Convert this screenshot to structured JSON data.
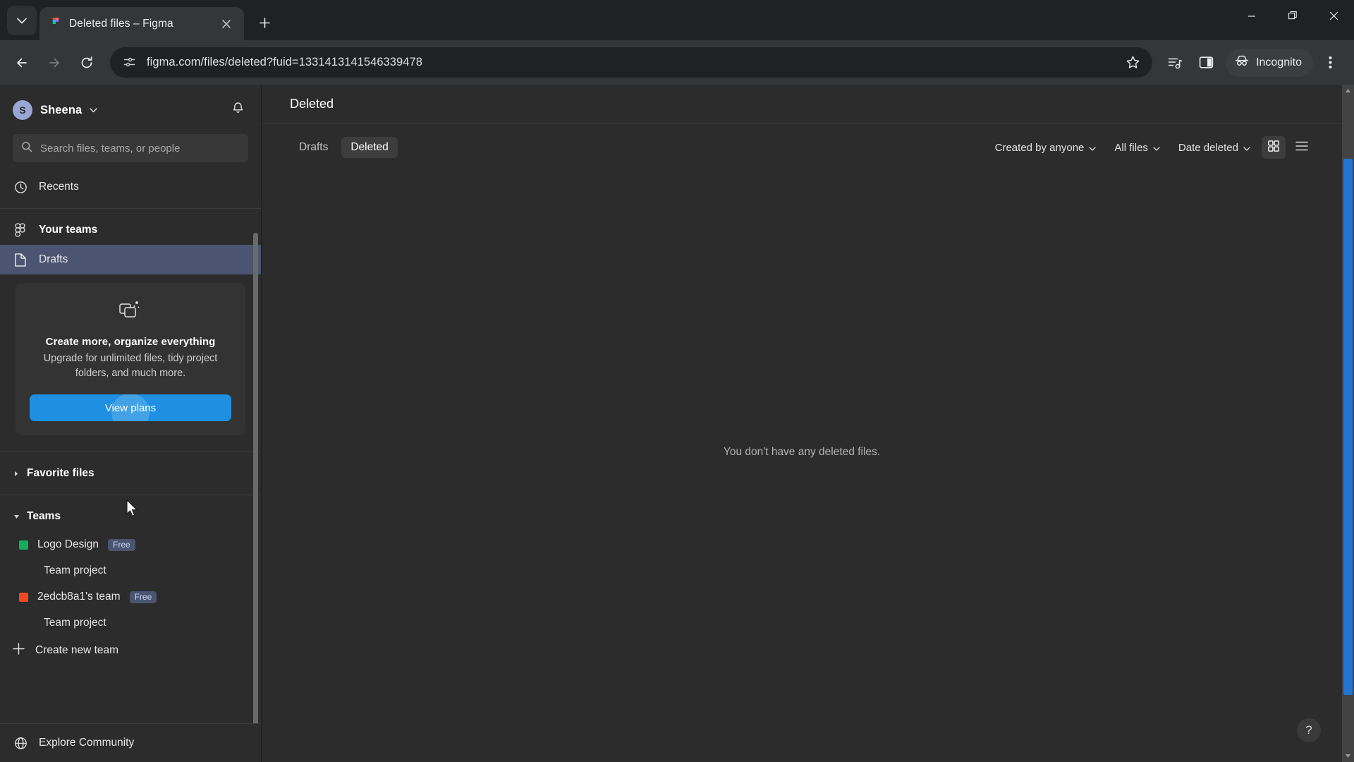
{
  "browser": {
    "tab": {
      "title": "Deleted files – Figma",
      "favicon_icon": "figma-favicon"
    },
    "tab_search_icon": "chevron-down-icon",
    "new_tab_icon": "plus-icon",
    "window_controls": {
      "minimize": "minimize-icon",
      "maximize": "restore-icon",
      "close": "close-icon"
    },
    "nav": {
      "back_icon": "arrow-left-icon",
      "forward_icon": "arrow-right-icon",
      "reload_icon": "reload-icon"
    },
    "omnibox": {
      "url": "figma.com/files/deleted?fuid=1331413141546339478",
      "site_info_icon": "site-settings-icon",
      "bookmark_icon": "star-icon"
    },
    "toolbar_icons": [
      "media-control-icon",
      "side-panel-icon"
    ],
    "incognito": {
      "label": "Incognito",
      "icon": "incognito-icon"
    },
    "menu_icon": "three-dot-menu-icon"
  },
  "sidebar": {
    "user": {
      "name": "Sheena",
      "initial": "S",
      "chevron_icon": "chevron-down-icon"
    },
    "notifications_icon": "bell-icon",
    "search": {
      "placeholder": "Search files, teams, or people",
      "icon": "search-icon"
    },
    "nav": [
      {
        "label": "Recents",
        "icon": "clock-icon",
        "selected": false
      },
      {
        "label": "Your teams",
        "icon": "figma-teams-icon",
        "selected": false
      },
      {
        "label": "Drafts",
        "icon": "file-icon",
        "selected": true
      }
    ],
    "upgrade_card": {
      "icon": "duplicate-sparkle-icon",
      "title": "Create more, organize everything",
      "subtitle": "Upgrade for unlimited files, tidy project folders, and much more.",
      "button_label": "View plans"
    },
    "favorites": {
      "label": "Favorite files",
      "expanded": false,
      "caret_icon": "caret-right-icon"
    },
    "teams_section": {
      "label": "Teams",
      "expanded": true,
      "caret_icon": "caret-down-icon"
    },
    "teams": [
      {
        "name": "Logo Design",
        "badge": "Free",
        "color": "#14ae5c",
        "projects": [
          "Team project"
        ]
      },
      {
        "name": "2edcb8a1's team",
        "badge": "Free",
        "color": "#f24822",
        "projects": [
          "Team project"
        ]
      }
    ],
    "create_team": {
      "label": "Create new team",
      "icon": "plus-icon"
    },
    "explore": {
      "label": "Explore Community",
      "icon": "globe-icon"
    }
  },
  "main": {
    "page_title": "Deleted",
    "tabs": [
      {
        "label": "Drafts",
        "active": false
      },
      {
        "label": "Deleted",
        "active": true
      }
    ],
    "filters": [
      {
        "label": "Created by anyone",
        "icon": "chevron-down-icon"
      },
      {
        "label": "All files",
        "icon": "chevron-down-icon"
      },
      {
        "label": "Date deleted",
        "icon": "chevron-down-icon"
      }
    ],
    "view_modes": [
      {
        "name": "grid-view",
        "icon": "grid-icon",
        "active": true
      },
      {
        "name": "list-view",
        "icon": "list-icon",
        "active": false
      }
    ],
    "empty_message": "You don't have any deleted files.",
    "help_label": "?"
  },
  "colors": {
    "accent_blue": "#1e8fe1",
    "selected_nav": "#4b5470",
    "scrollbar_thumb": "#2274d4",
    "sidebar_bg": "#2c2c2c"
  }
}
